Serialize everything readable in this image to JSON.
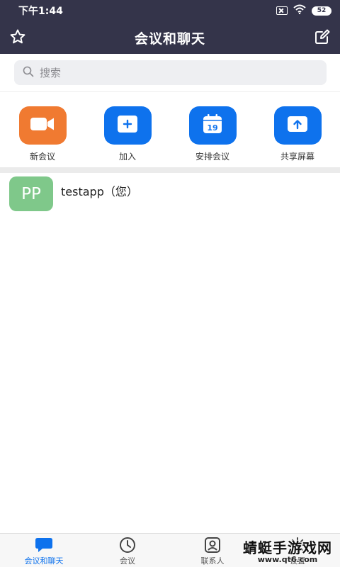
{
  "status_bar": {
    "time": "下午1:44",
    "battery": "52"
  },
  "header": {
    "title": "会议和聊天",
    "left_icon": "star-icon",
    "right_icon": "edit-icon"
  },
  "search": {
    "placeholder": "搜索"
  },
  "actions": [
    {
      "label": "新会议",
      "icon": "video-camera-icon",
      "color": "#f07a31"
    },
    {
      "label": "加入",
      "icon": "plus-icon",
      "color": "#0e72ed"
    },
    {
      "label": "安排会议",
      "icon": "calendar-icon",
      "color": "#0e72ed",
      "calendar_day": "19"
    },
    {
      "label": "共享屏幕",
      "icon": "share-screen-icon",
      "color": "#0e72ed"
    }
  ],
  "contacts": [
    {
      "initials": "PP",
      "name": "testapp（您）",
      "avatar_color": "#7fc88a"
    }
  ],
  "bottom_nav": [
    {
      "label": "会议和聊天",
      "icon": "chat-bubble-icon",
      "active": true
    },
    {
      "label": "会议",
      "icon": "clock-icon",
      "active": false
    },
    {
      "label": "联系人",
      "icon": "contact-icon",
      "active": false
    },
    {
      "label": "设置",
      "icon": "gear-icon",
      "active": false
    }
  ],
  "watermark": {
    "line1": "蜻蜓手游戏网",
    "line2": "www.qt6.com"
  },
  "colors": {
    "header_bg": "#34344a",
    "accent_blue": "#0e72ed",
    "accent_orange": "#f07a31"
  }
}
